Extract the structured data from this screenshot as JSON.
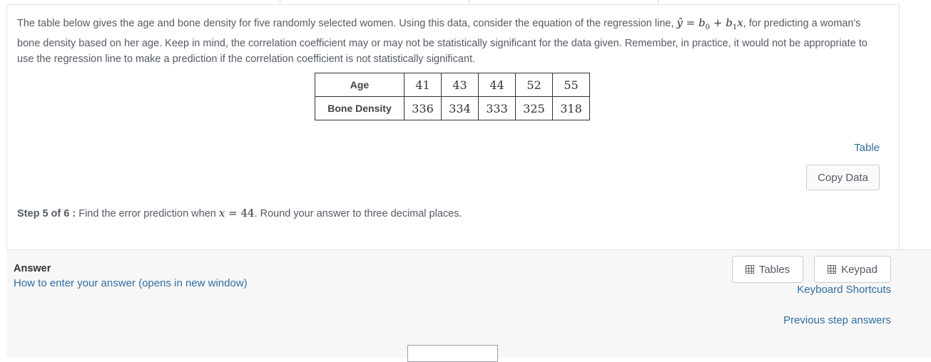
{
  "question": {
    "intro_part1": "The table below gives the age and bone density for five randomly selected women. Using this data, consider the equation of the regression line, ",
    "regression_equation": {
      "yhat": "ŷ",
      "eq": " = ",
      "b0": "b",
      "b0_sub": "0",
      "plus": " + ",
      "b1": "b",
      "b1_sub": "1",
      "x": "x"
    },
    "intro_part2": ", for predicting a woman's bone density based on her age. Keep in mind, the correlation coefficient may or may not be statistically significant for the data given. Remember, in practice, it would not be appropriate to use the regression line to make a prediction if the correlation coefficient is not statistically significant."
  },
  "data_table": {
    "rows": [
      {
        "header": "Age",
        "values": [
          "41",
          "43",
          "44",
          "52",
          "55"
        ]
      },
      {
        "header": "Bone Density",
        "values": [
          "336",
          "334",
          "333",
          "325",
          "318"
        ]
      }
    ]
  },
  "table_link": "Table",
  "copy_data_button": "Copy Data",
  "step": {
    "label": "Step 5 of 6 :",
    "text_before": " Find the error prediction when ",
    "var": "x",
    "equals": " = ",
    "value": "44",
    "text_after": ". Round your answer to three decimal places."
  },
  "answer": {
    "label": "Answer",
    "how_to_link": "How to enter your answer (opens in new window)",
    "tables_button": "Tables",
    "keypad_button": "Keypad",
    "keyboard_shortcuts_link": "Keyboard Shortcuts",
    "previous_step_link": "Previous step answers",
    "input_value": ""
  }
}
